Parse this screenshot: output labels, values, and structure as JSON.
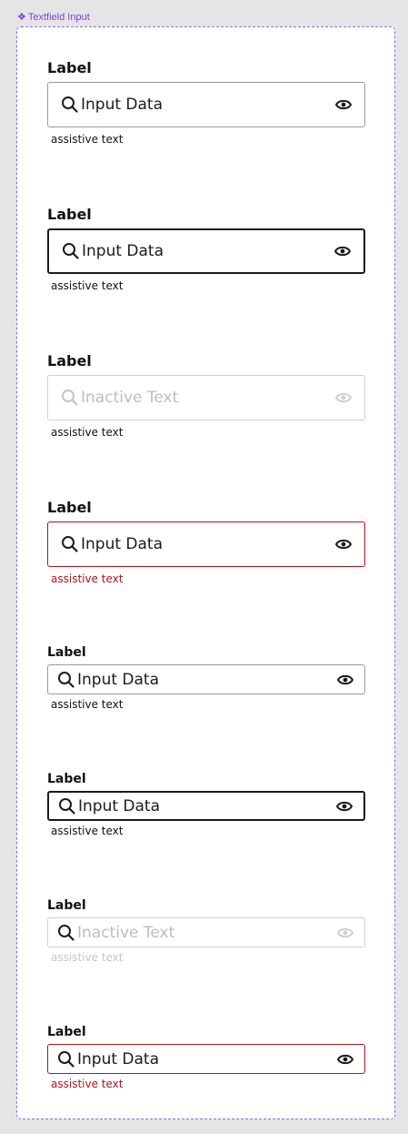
{
  "component_tag": {
    "icon": "component-diamond-icon",
    "glyph": "❖",
    "label": "Textfield Input"
  },
  "colors": {
    "frame_border": "#8b68f5",
    "tag_text": "#7b3fe0",
    "text": "#1b1b1b",
    "border_default": "#9a9a9a",
    "border_focused": "#1a1a1a",
    "disabled": "#bdbdbd",
    "error": "#b3131b"
  },
  "fields": [
    {
      "size": "large",
      "state": "default",
      "label": "Label",
      "value": "Input Data",
      "assistive": "assistive text",
      "leading_icon": "search-icon",
      "trailing_icon": "eye-icon"
    },
    {
      "size": "large",
      "state": "focused",
      "label": "Label",
      "value": "Input Data",
      "assistive": "assistive text",
      "leading_icon": "search-icon",
      "trailing_icon": "eye-icon"
    },
    {
      "size": "large",
      "state": "disabled",
      "label": "Label",
      "value": "Inactive Text",
      "assistive": "assistive text",
      "leading_icon": "search-icon",
      "trailing_icon": "eye-icon"
    },
    {
      "size": "large",
      "state": "error",
      "label": "Label",
      "value": "Input Data",
      "assistive": "assistive text",
      "leading_icon": "search-icon",
      "trailing_icon": "eye-icon"
    },
    {
      "size": "small",
      "state": "default",
      "label": "Label",
      "value": "Input Data",
      "assistive": "assistive text",
      "leading_icon": "search-icon",
      "trailing_icon": "eye-icon"
    },
    {
      "size": "small",
      "state": "focused",
      "label": "Label",
      "value": "Input Data",
      "assistive": "assistive text",
      "leading_icon": "search-icon",
      "trailing_icon": "eye-icon"
    },
    {
      "size": "small",
      "state": "disabled",
      "label": "Label",
      "value": "Inactive Text",
      "assistive": "assistive text",
      "leading_icon": "search-icon",
      "trailing_icon": "eye-icon"
    },
    {
      "size": "small",
      "state": "error",
      "label": "Label",
      "value": "Input Data",
      "assistive": "assistive text",
      "leading_icon": "search-icon",
      "trailing_icon": "eye-icon"
    }
  ]
}
